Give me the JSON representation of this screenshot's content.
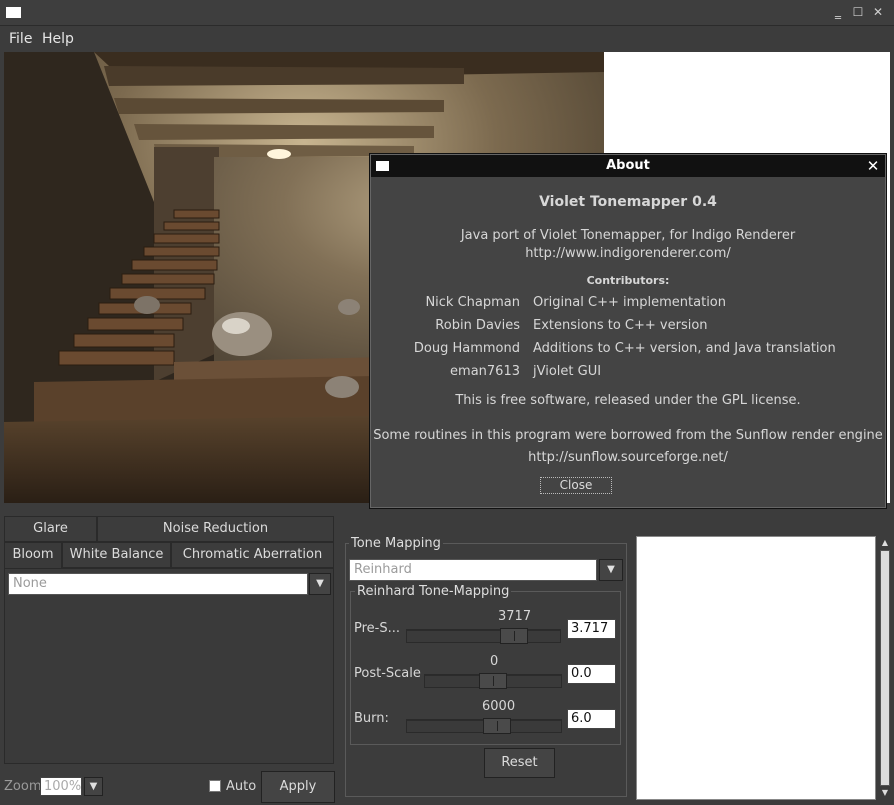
{
  "window": {
    "minimize_glyph": "‗",
    "maximize_glyph": "☐",
    "close_glyph": "✕"
  },
  "menu": {
    "file": "File",
    "help": "Help"
  },
  "about": {
    "title": "About",
    "close_glyph": "✕",
    "app_name": "Violet Tonemapper 0.4",
    "description": "Java port of Violet Tonemapper, for Indigo Renderer",
    "url": "http://www.indigorenderer.com/",
    "contributors_heading": "Contributors:",
    "contributors": [
      {
        "name": "Nick Chapman",
        "role": "Original C++ implementation"
      },
      {
        "name": "Robin Davies",
        "role": "Extensions to C++ version"
      },
      {
        "name": "Doug Hammond",
        "role": "Additions to C++ version, and Java translation"
      },
      {
        "name": "eman7613",
        "role": "jViolet GUI"
      }
    ],
    "license": "This is free software, released under the GPL license.",
    "sunflow_note": "Some routines in this program were borrowed from the Sunflow render engine",
    "sunflow_url": "http://sunflow.sourceforge.net/",
    "close_button": "Close"
  },
  "tabs": {
    "row1": [
      "Glare",
      "Noise Reduction"
    ],
    "row2": [
      "Bloom",
      "White Balance",
      "Chromatic Aberration"
    ],
    "active": "Bloom"
  },
  "bloom": {
    "select_value": "None"
  },
  "zoom": {
    "label": "Zoom",
    "value": "100%"
  },
  "auto": {
    "label": "Auto",
    "checked": false
  },
  "apply_button": "Apply",
  "tone_mapping": {
    "group_label": "Tone Mapping",
    "method": "Reinhard",
    "sub_group_label": "Reinhard Tone-Mapping",
    "pre_scale": {
      "label": "Pre-S...",
      "tick": "3717",
      "value": "3.717",
      "level": 0.55
    },
    "post_scale": {
      "label": "Post-Scale",
      "tick": "0",
      "value": "0.0",
      "level": 0.5
    },
    "burn": {
      "label": "Burn:",
      "tick": "6000",
      "value": "6.0",
      "level": 0.5
    },
    "reset_button": "Reset"
  },
  "colors": {
    "dialog_title_bg": "#111111",
    "white_panel": "#ffffff",
    "window_bg": "#3c3c3c"
  }
}
